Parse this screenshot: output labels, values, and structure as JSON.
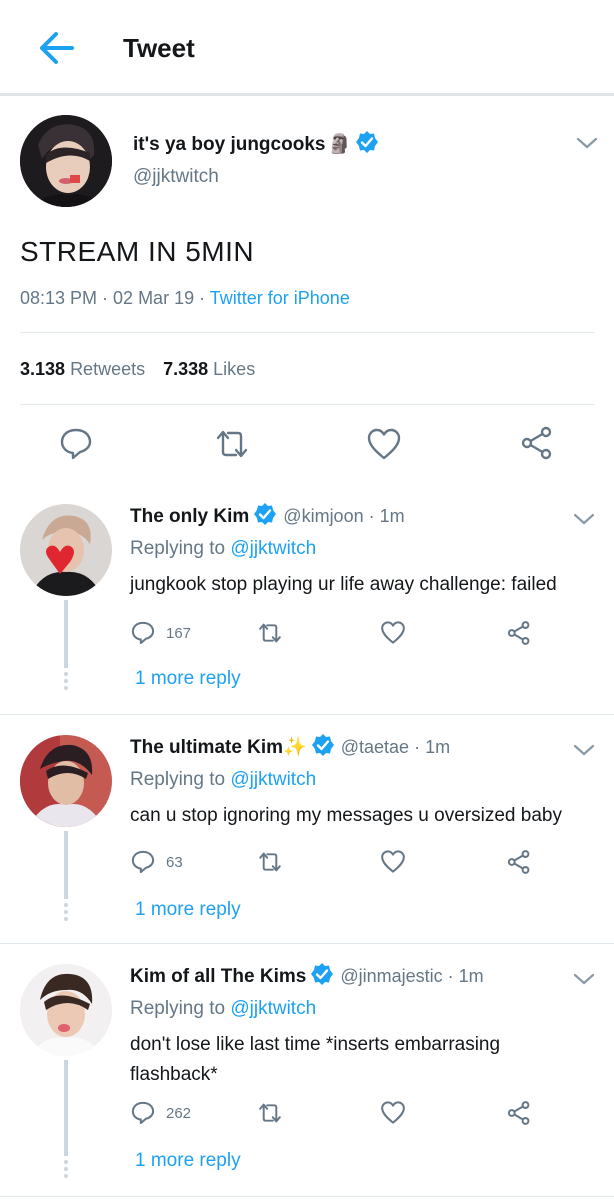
{
  "header": {
    "title": "Tweet",
    "back_icon": "arrow-left-icon",
    "accent": "#1da1f2"
  },
  "main_tweet": {
    "display_name": "it's ya boy jungcooks",
    "name_emoji": "🗿",
    "handle": "@jjktwitch",
    "verified": true,
    "text": "STREAM IN 5MIN",
    "timestamp": "08:13 PM · 02 Mar 19 · ",
    "source": "Twitter for iPhone",
    "retweets_count": "3.138",
    "retweets_label": "Retweets",
    "likes_count": "7.338",
    "likes_label": "Likes"
  },
  "replies": [
    {
      "display_name": "The only Kim",
      "handle": "@kimjoon · 1m",
      "replying_prefix": "Replying to ",
      "replying_to": "@jjktwitch",
      "text": "jungkook stop playing ur life away challenge: failed",
      "reply_count": "167",
      "more_replies": "1 more reply"
    },
    {
      "display_name": "The ultimate Kim",
      "name_emoji": "✨",
      "handle": "@taetae · 1m",
      "replying_prefix": "Replying to ",
      "replying_to": "@jjktwitch",
      "text": "can u stop ignoring my messages u oversized baby",
      "reply_count": "63",
      "more_replies": "1 more reply"
    },
    {
      "display_name": "Kim of all The Kims",
      "handle": "@jinmajestic · 1m",
      "replying_prefix": "Replying to ",
      "replying_to": "@jjktwitch",
      "text": "don't lose like last time *inserts embarrasing flashback*",
      "reply_count": "262",
      "more_replies": "1 more reply"
    }
  ]
}
